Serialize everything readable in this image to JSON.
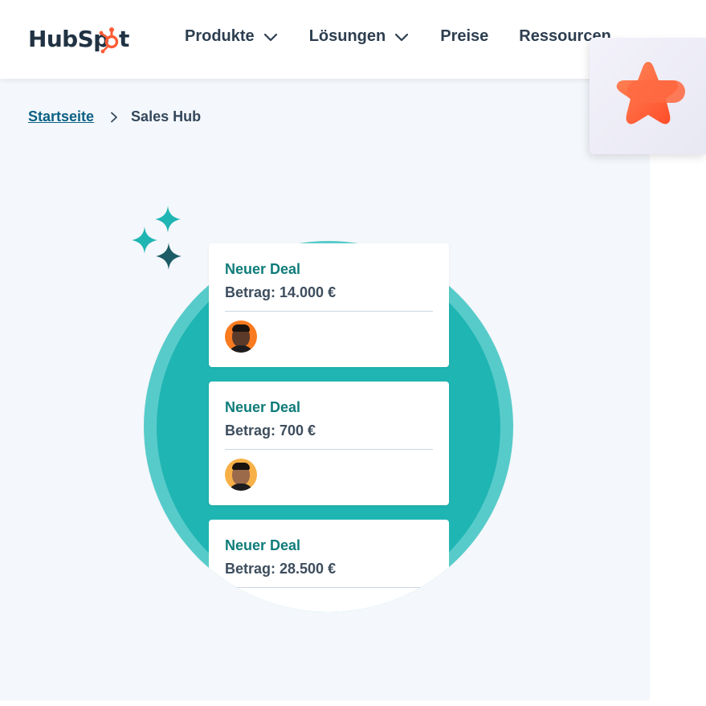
{
  "header": {
    "logo_text": "HubSpot",
    "nav": [
      {
        "label": "Produkte",
        "has_dropdown": true
      },
      {
        "label": "Lösungen",
        "has_dropdown": true
      },
      {
        "label": "Preise",
        "has_dropdown": false
      },
      {
        "label": "Ressourcen",
        "has_dropdown": false
      }
    ]
  },
  "breadcrumb": {
    "home": "Startseite",
    "current": "Sales Hub"
  },
  "deals": [
    {
      "title": "Neuer Deal",
      "amount": "Betrag: 14.000 €",
      "avatar_bg": "#f97a1f"
    },
    {
      "title": "Neuer Deal",
      "amount": "Betrag: 700 €",
      "avatar_bg": "#f7b047"
    },
    {
      "title": "Neuer Deal",
      "amount": "Betrag: 28.500 €"
    }
  ],
  "floating_widget": {
    "icon": "star-icon"
  },
  "colors": {
    "brand_orange": "#ff5c35",
    "teal_dark": "#1fb5b3",
    "teal_light": "#57cbca",
    "deal_title": "#0f7c7a",
    "link": "#0b6185",
    "page_bg": "#f4f7fb"
  }
}
